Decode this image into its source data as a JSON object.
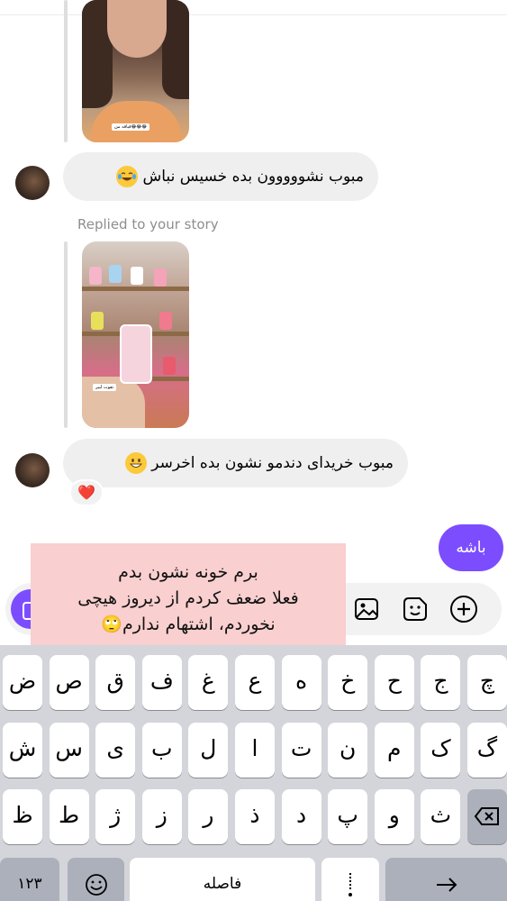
{
  "conversation": {
    "replied_label": "Replied to your story",
    "story1": {
      "sticker_text": "قیافه من😂😂😂"
    },
    "message1": {
      "text": "مبوب نشووووون بده خسیس نباش",
      "emoji": "joy-tears-emoji"
    },
    "story2": {
      "sticker_text": "تقوت ليير"
    },
    "message2": {
      "text": "مبوب خریدای دندمو نشون بده اخرسر",
      "emoji": "grinning-emoji"
    },
    "reaction": "❤️",
    "my_message": "باشه"
  },
  "composer": {
    "icons": [
      "camera-icon",
      "gallery-icon",
      "sticker-icon",
      "plus-icon"
    ]
  },
  "overlay_note": {
    "line1": "برم خونه نشون بدم",
    "line2": "فعلا ضعف کردم از دیروز هیچی",
    "line3": "نخوردم، اشتهام ندارم🙄"
  },
  "keyboard": {
    "row1": [
      "ض",
      "ص",
      "ق",
      "ف",
      "غ",
      "ع",
      "ه",
      "خ",
      "ح",
      "ج",
      "چ"
    ],
    "row2": [
      "ش",
      "س",
      "ی",
      "ب",
      "ل",
      "ا",
      "ت",
      "ن",
      "م",
      "ک",
      "گ"
    ],
    "row3": [
      "ظ",
      "ط",
      "ژ",
      "ز",
      "ر",
      "ذ",
      "د",
      "پ",
      "و",
      "ث"
    ],
    "numbers_key": "۱۲۳",
    "emoji_key": "☺",
    "space_label": "فاصله",
    "punctuation_key": "؟",
    "return_key": "⮐"
  }
}
